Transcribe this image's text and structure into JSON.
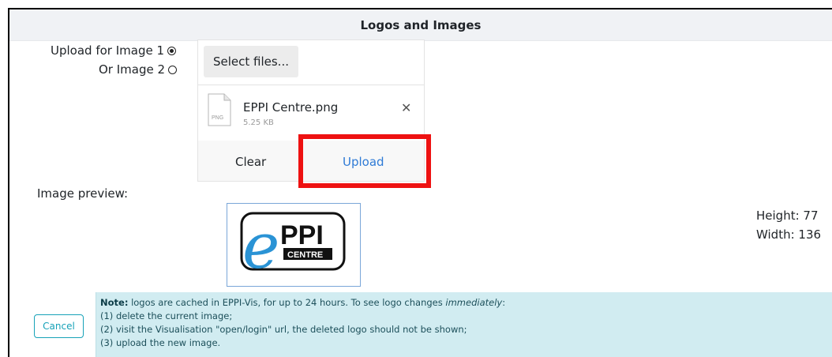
{
  "panel": {
    "title": "Logos and Images"
  },
  "upload_target": {
    "image1_label": "Upload for Image 1",
    "image2_label": "Or Image 2",
    "selected": "Image 1"
  },
  "uploader": {
    "select_label": "Select files...",
    "file": {
      "name": "EPPI Centre.png",
      "size": "5.25 KB",
      "type_badge": "PNG"
    },
    "clear_label": "Clear",
    "upload_label": "Upload"
  },
  "preview": {
    "label": "Image preview:",
    "logo_text": "PPI",
    "logo_letter": "e",
    "logo_sub": "CENTRE",
    "height_text": "Height: 77",
    "width_text": "Width: 136"
  },
  "note": {
    "lead": "Note:",
    "text_before": " logos are cached in EPPI-Vis, for up to 24 hours. To see logo changes ",
    "emph": "immediately",
    "text_after": ":",
    "steps": [
      "(1) delete the current image;",
      "(2) visit the Visualisation \"open/login\" url, the deleted logo should not be shown;",
      "(3) upload the new image."
    ]
  },
  "cancel_label": "Cancel",
  "colors": {
    "highlight": "#ee1111",
    "link": "#2f7bd6",
    "info_bg": "#d1ecf1"
  }
}
